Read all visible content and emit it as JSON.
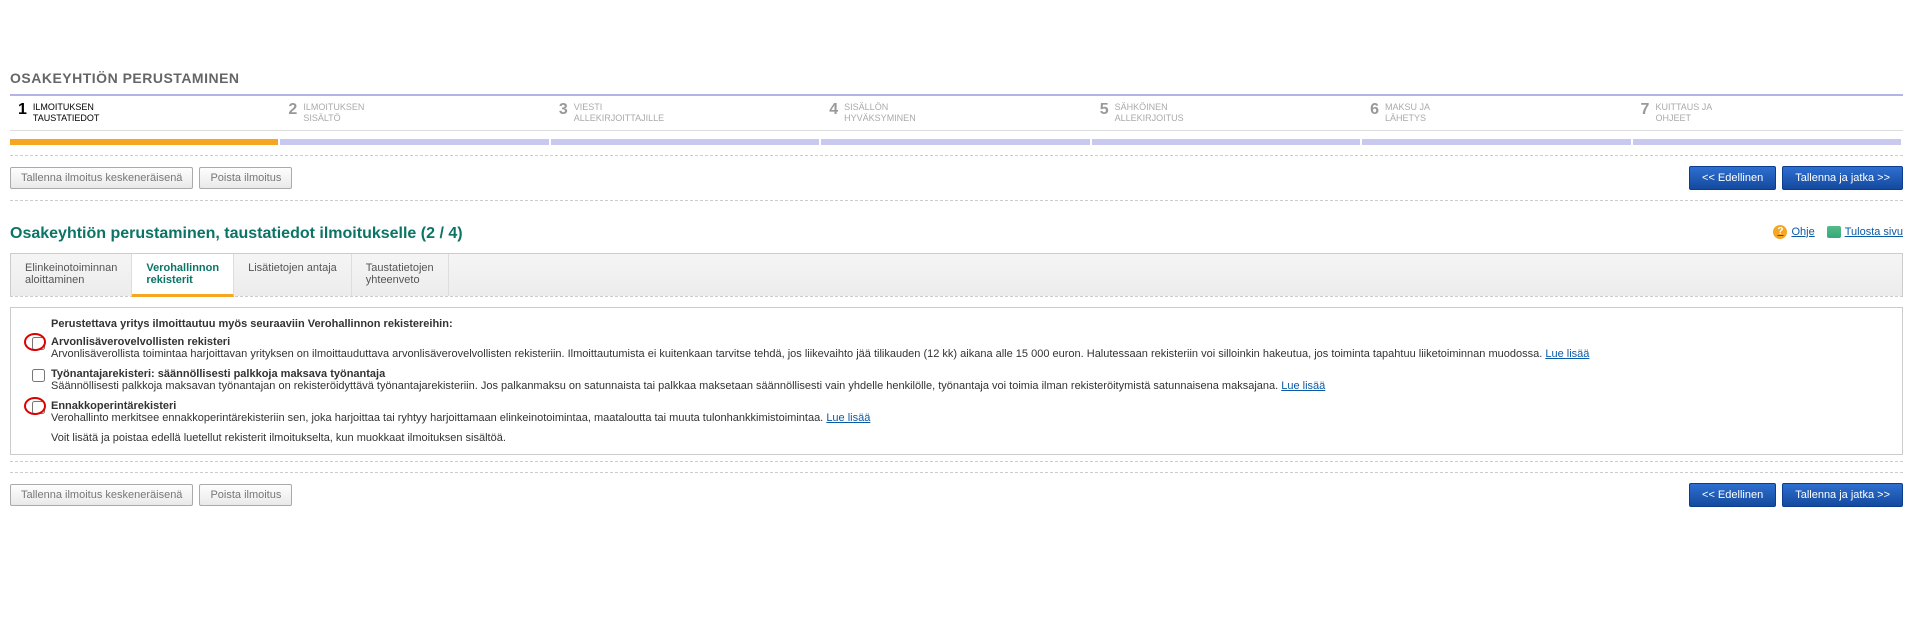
{
  "page_title": "OSAKEYHTIÖN PERUSTAMINEN",
  "wizard": [
    {
      "num": "1",
      "line1": "ILMOITUKSEN",
      "line2": "TAUSTATIEDOT",
      "active": true
    },
    {
      "num": "2",
      "line1": "ILMOITUKSEN",
      "line2": "SISÄLTÖ",
      "active": false
    },
    {
      "num": "3",
      "line1": "VIESTI",
      "line2": "ALLEKIRJOITTAJILLE",
      "active": false
    },
    {
      "num": "4",
      "line1": "SISÄLLÖN",
      "line2": "HYVÄKSYMINEN",
      "active": false
    },
    {
      "num": "5",
      "line1": "SÄHKÖINEN",
      "line2": "ALLEKIRJOITUS",
      "active": false
    },
    {
      "num": "6",
      "line1": "MAKSU JA",
      "line2": "LÄHETYS",
      "active": false
    },
    {
      "num": "7",
      "line1": "KUITTAUS JA",
      "line2": "OHJEET",
      "active": false
    }
  ],
  "buttons": {
    "save_draft": "Tallenna ilmoitus keskeneräisenä",
    "delete": "Poista ilmoitus",
    "prev": "<< Edellinen",
    "next": "Tallenna ja jatka >>"
  },
  "section_heading": "Osakeyhtiön perustaminen, taustatiedot ilmoitukselle (2 / 4)",
  "help": {
    "help_label": "Ohje",
    "print_label": "Tulosta sivu"
  },
  "tabs": [
    {
      "line1": "Elinkeinotoiminnan",
      "line2": "aloittaminen",
      "active": false
    },
    {
      "line1": "Verohallinnon",
      "line2": "rekisterit",
      "active": true
    },
    {
      "line1": "Lisätietojen antaja",
      "line2": "",
      "active": false
    },
    {
      "line1": "Taustatietojen",
      "line2": "yhteenveto",
      "active": false
    }
  ],
  "registers": {
    "intro": "Perustettava yritys ilmoittautuu myös seuraaviin Verohallinnon rekistereihin:",
    "items": [
      {
        "title": "Arvonlisäverovelvollisten rekisteri",
        "desc": "Arvonlisäverollista toimintaa harjoittavan yrityksen on ilmoittauduttava arvonlisäverovelvollisten rekisteriin. Ilmoittautumista ei kuitenkaan tarvitse tehdä, jos liikevaihto jää tilikauden (12 kk) aikana alle 15 000 euron. Halutessaan rekisteriin voi silloinkin hakeutua, jos toiminta tapahtuu liiketoiminnan muodossa.",
        "link": "Lue lisää",
        "highlighted": true
      },
      {
        "title": "Työnantajarekisteri: säännöllisesti palkkoja maksava työnantaja",
        "desc": "Säännöllisesti palkkoja maksavan työnantajan on rekisteröidyttävä työnantajarekisteriin. Jos palkanmaksu on satunnaista tai palkkaa maksetaan säännöllisesti vain yhdelle henkilölle, työnantaja voi toimia ilman rekisteröitymistä satunnaisena maksajana.",
        "link": "Lue lisää",
        "highlighted": false
      },
      {
        "title": "Ennakkoperintärekisteri",
        "desc": "Verohallinto merkitsee ennakkoperintärekisteriin sen, joka harjoittaa tai ryhtyy harjoittamaan elinkeinotoimintaa, maataloutta tai muuta tulonhankkimistoimintaa.",
        "link": "Lue lisää",
        "highlighted": true
      }
    ],
    "footer": "Voit lisätä ja poistaa edellä luetellut rekisterit ilmoitukselta, kun muokkaat ilmoituksen sisältöä."
  }
}
